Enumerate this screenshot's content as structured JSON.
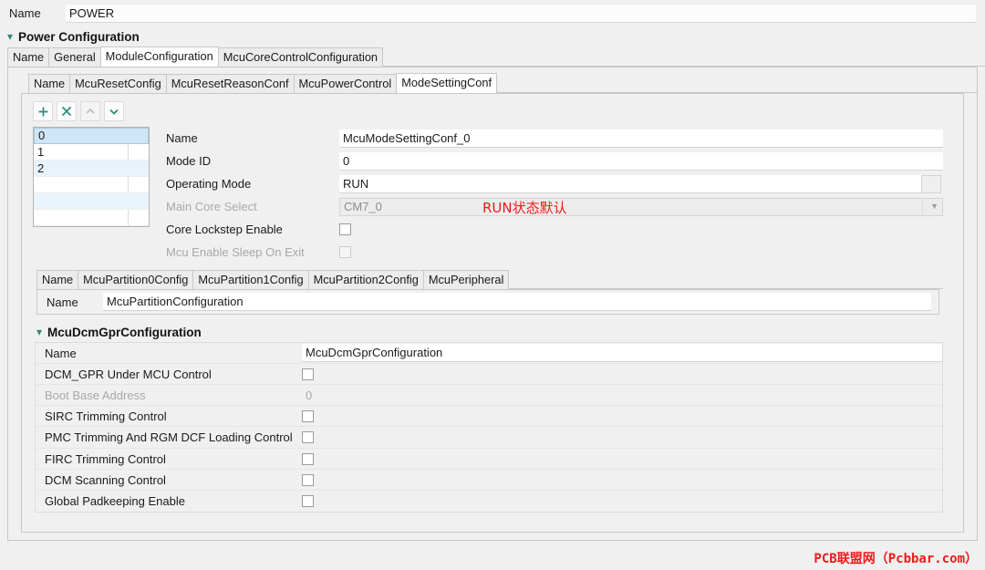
{
  "top": {
    "name_label": "Name",
    "name_value": "POWER"
  },
  "section": {
    "twisty": "chevron-down-icon",
    "title": "Power Configuration"
  },
  "outer_tabs": [
    {
      "label": "Name",
      "active": false
    },
    {
      "label": "General",
      "active": false
    },
    {
      "label": "ModuleConfiguration",
      "active": true
    },
    {
      "label": "McuCoreControlConfiguration",
      "active": false
    }
  ],
  "inner_tabs": [
    {
      "label": "Name",
      "active": false
    },
    {
      "label": "McuResetConfig",
      "active": false
    },
    {
      "label": "McuResetReasonConf",
      "active": false
    },
    {
      "label": "McuPowerControl",
      "active": false
    },
    {
      "label": "ModeSettingConf",
      "active": true
    }
  ],
  "toolbar": [
    {
      "name": "add-button",
      "glyph": "+",
      "disabled": false
    },
    {
      "name": "delete-button",
      "glyph": "×",
      "disabled": false
    },
    {
      "name": "move-up-button",
      "glyph": "∧",
      "disabled": true
    },
    {
      "name": "move-down-button",
      "glyph": "∨",
      "disabled": false
    }
  ],
  "list": {
    "items": [
      {
        "label": "0",
        "selected": true
      },
      {
        "label": "1",
        "selected": false
      },
      {
        "label": "2",
        "selected": false
      }
    ]
  },
  "properties": {
    "name": {
      "label": "Name",
      "value": "McuModeSettingConf_0"
    },
    "mode_id": {
      "label": "Mode ID",
      "value": "0"
    },
    "operating_mode": {
      "label": "Operating Mode",
      "value": "RUN"
    },
    "main_core_select": {
      "label": "Main Core Select",
      "value": "CM7_0",
      "disabled": true
    },
    "core_lockstep": {
      "label": "Core Lockstep Enable",
      "checked": false,
      "disabled": false
    },
    "sleep_on_exit": {
      "label": "Mcu Enable Sleep On Exit",
      "checked": false,
      "disabled": true
    }
  },
  "partition_tabs": [
    {
      "label": "Name",
      "active": false
    },
    {
      "label": "McuPartition0Config",
      "active": false
    },
    {
      "label": "McuPartition1Config",
      "active": false
    },
    {
      "label": "McuPartition2Config",
      "active": false
    },
    {
      "label": "McuPeripheral",
      "active": false
    }
  ],
  "partition_panel": {
    "name_label": "Name",
    "name_value": "McuPartitionConfiguration"
  },
  "dcm_section": {
    "twisty": "chevron-down-icon",
    "title": "McuDcmGprConfiguration"
  },
  "dcm_rows": [
    {
      "label": "Name",
      "type": "text",
      "value": "McuDcmGprConfiguration",
      "disabled": false
    },
    {
      "label": "DCM_GPR Under MCU Control",
      "type": "checkbox",
      "checked": false,
      "disabled": false
    },
    {
      "label": "Boot Base Address",
      "type": "plain",
      "value": "0",
      "disabled": true
    },
    {
      "label": "SIRC Trimming Control",
      "type": "checkbox",
      "checked": false,
      "disabled": false
    },
    {
      "label": "PMC Trimming And RGM DCF Loading Control",
      "type": "checkbox",
      "checked": false,
      "disabled": false
    },
    {
      "label": "FIRC Trimming Control",
      "type": "checkbox",
      "checked": false,
      "disabled": false
    },
    {
      "label": "DCM Scanning Control",
      "type": "checkbox",
      "checked": false,
      "disabled": false
    },
    {
      "label": "Global Padkeeping Enable",
      "type": "checkbox",
      "checked": false,
      "disabled": false
    }
  ],
  "annotations": {
    "run_note": "RUN状态默认",
    "watermark": "PCB联盟网（Pcbbar.com）"
  },
  "colors": {
    "accent": "#2e8b78",
    "annotation": "#f01a1a",
    "selection": "#cfe6f7",
    "panel_bg": "#f0f0f0"
  }
}
